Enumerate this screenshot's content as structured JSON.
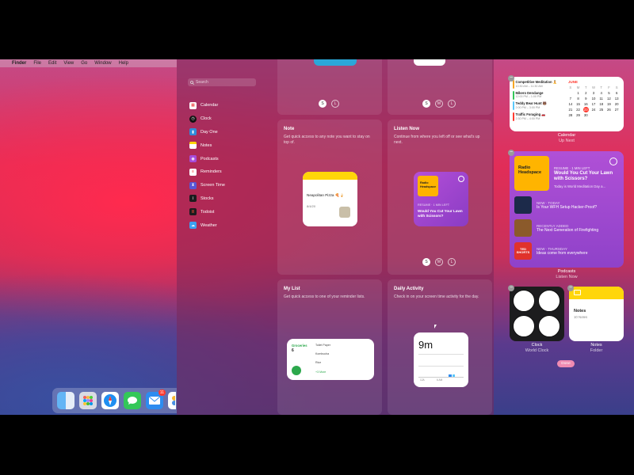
{
  "menubar": {
    "app": "Finder",
    "items": [
      "File",
      "Edit",
      "View",
      "Go",
      "Window",
      "Help"
    ]
  },
  "dock": {
    "mail_badge": "11"
  },
  "gallery": {
    "search_placeholder": "Search",
    "apps": [
      "Calendar",
      "Clock",
      "Day One",
      "Notes",
      "Podcasts",
      "Reminders",
      "Screen Time",
      "Stocks",
      "Todoist",
      "Weather"
    ],
    "panels": {
      "note": {
        "title": "Note",
        "desc": "Get quick access to any note you want to stay on top of.",
        "note_title": "Neapolitan Pizza 🍕🍦",
        "note_meta": "8/4/20"
      },
      "listen_now": {
        "title": "Listen Now",
        "desc": "Continue from where you left off or see what's up next.",
        "tag": "RESUME · 1 MIN LEFT",
        "episode": "Would You Cut Your Lawn with Scissors?",
        "artwork": "Radio Headspace"
      },
      "my_list": {
        "title": "My List",
        "desc": "Get quick access to one of your reminder lists.",
        "list_name": "Groceries",
        "count": "6",
        "items": [
          "Toilet Paper",
          "Kombucha",
          "Rice",
          "+3 More"
        ]
      },
      "daily_activity": {
        "title": "Daily Activity",
        "desc": "Check in on your screen time activity for the day.",
        "value": "9m",
        "axis": [
          "12A",
          "6 AM"
        ]
      }
    },
    "size_labels": {
      "small": "S",
      "medium": "M",
      "large": "L"
    }
  },
  "right": {
    "calendar": {
      "events": [
        {
          "name": "Competitive Meditation 🧘",
          "time": "10:30 AM – 11:30 AM",
          "color": "#f5a623"
        },
        {
          "name": "Mikero Dendange",
          "time": "12:00 PM – 1:00 PM",
          "color": "#34c759"
        },
        {
          "name": "Teddy Bear Hunt 🐻",
          "time": "2:00 PM – 3:00 PM",
          "color": "#5ac8fa"
        },
        {
          "name": "Traffic Foraging 🚗",
          "time": "2:30 PM – 4:00 PM",
          "color": "#ff3b30"
        }
      ],
      "month": "JUNE",
      "weekdays": [
        "S",
        "M",
        "T",
        "W",
        "T",
        "F",
        "S"
      ],
      "days": [
        "",
        "1",
        "2",
        "3",
        "4",
        "5",
        "6",
        "7",
        "8",
        "9",
        "10",
        "11",
        "12",
        "13",
        "14",
        "15",
        "16",
        "17",
        "18",
        "19",
        "20",
        "21",
        "22",
        "23",
        "24",
        "25",
        "26",
        "27",
        "28",
        "29",
        "30",
        "",
        "",
        "",
        "",
        ""
      ],
      "today": "23",
      "caption": "Calendar",
      "subcaption": "Up Next"
    },
    "podcasts": {
      "top_tag": "RESUME · 1 MIN LEFT",
      "top_title": "Would You Cut Your Lawn with Scissors?",
      "top_sub": "Today is World Meditation Day a...",
      "artwork": "Radio Headspace",
      "rows": [
        {
          "tag": "NEW · TODAY",
          "title": "Is Your WFH Setup Hacker-Proof?"
        },
        {
          "tag": "RECENTLY ADDED",
          "title": "The Next Generation of Firefighting"
        },
        {
          "tag": "NEW · THURSDAY",
          "title": "Ideas come from everywhere"
        }
      ],
      "third_artwork": "TED SHORTS",
      "caption": "Podcasts",
      "subcaption": "Listen Now"
    },
    "clock": {
      "caption": "Clock",
      "subcaption": "World Clock"
    },
    "notes": {
      "title": "Notes",
      "count": "10 Notes",
      "caption": "Notes",
      "subcaption": "Folder"
    },
    "done_label": "Done"
  },
  "colors": {
    "accent_purple": "#a64bd9",
    "note_yellow": "#ffd60a",
    "done_pink": "#f08bb2"
  }
}
